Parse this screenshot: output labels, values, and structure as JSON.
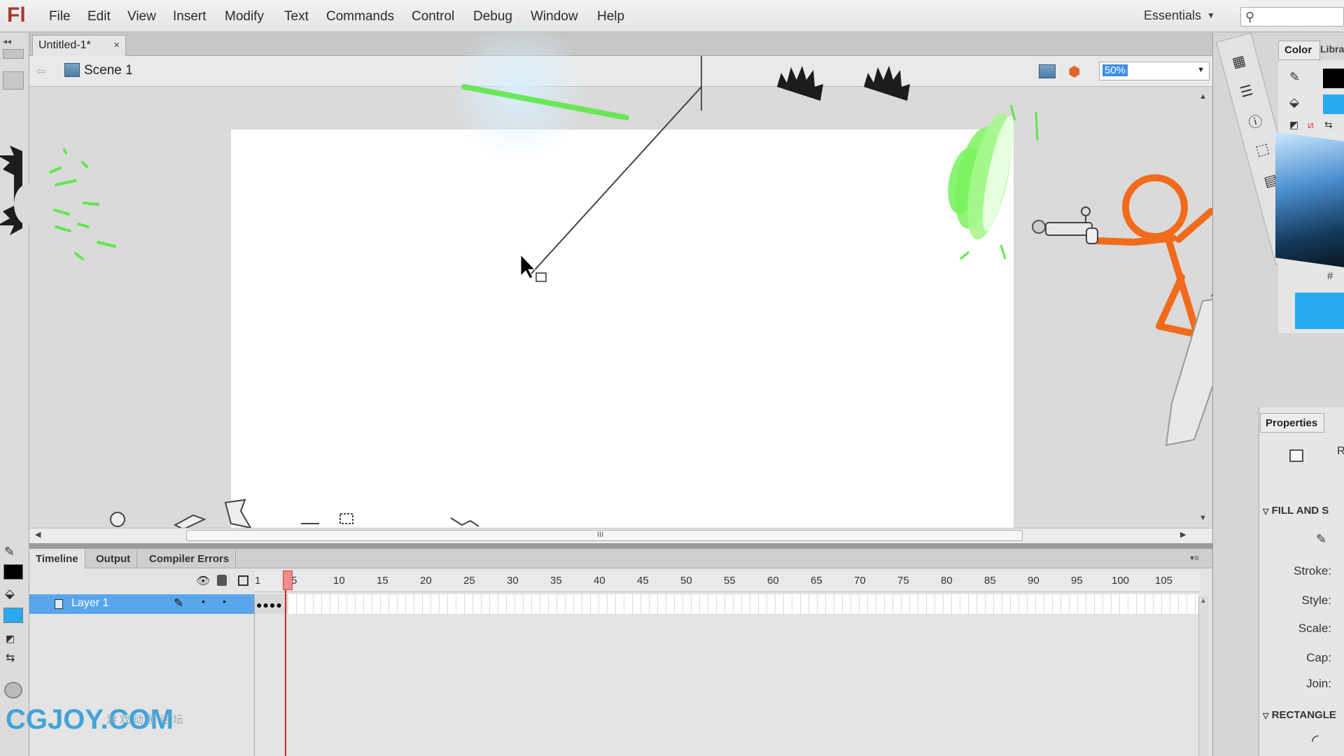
{
  "app": {
    "logo": "Fl"
  },
  "menu": {
    "items": [
      "File",
      "Edit",
      "View",
      "Insert",
      "Modify",
      "Text",
      "Commands",
      "Control",
      "Debug",
      "Window",
      "Help"
    ],
    "workspace": "Essentials"
  },
  "document": {
    "tab_title": "Untitled-1*",
    "close_glyph": "×",
    "scene_label": "Scene 1",
    "zoom": "50%",
    "scroll_grip": "III"
  },
  "timeline": {
    "tabs": [
      "Timeline",
      "Output",
      "Compiler Errors"
    ],
    "frame_numbers": [
      "1",
      "5",
      "10",
      "15",
      "20",
      "25",
      "30",
      "35",
      "40",
      "45",
      "50",
      "55",
      "60",
      "65",
      "70",
      "75",
      "80",
      "85",
      "90",
      "95",
      "100",
      "105"
    ],
    "layer_name": "Layer 1",
    "current_frame": 5
  },
  "panels": {
    "color_tab": "Color",
    "library_tab": "Libra",
    "hash": "#",
    "properties_tab": "Properties",
    "fill_stroke_header": "FILL AND S",
    "rectangle_header": "RECTANGLE",
    "stroke_label": "Stroke:",
    "style_label": "Style:",
    "scale_label": "Scale:",
    "cap_label": "Cap:",
    "join_label": "Join:",
    "props_letter": "R"
  },
  "colors": {
    "accent_blue": "#29a9f0",
    "stick_orange": "#f26b1d",
    "glow_green": "#5ee84a",
    "playhead": "#f28b8b"
  },
  "watermark": {
    "brand": "CGJOY.COM",
    "chinese": "游戏动画论坛"
  }
}
